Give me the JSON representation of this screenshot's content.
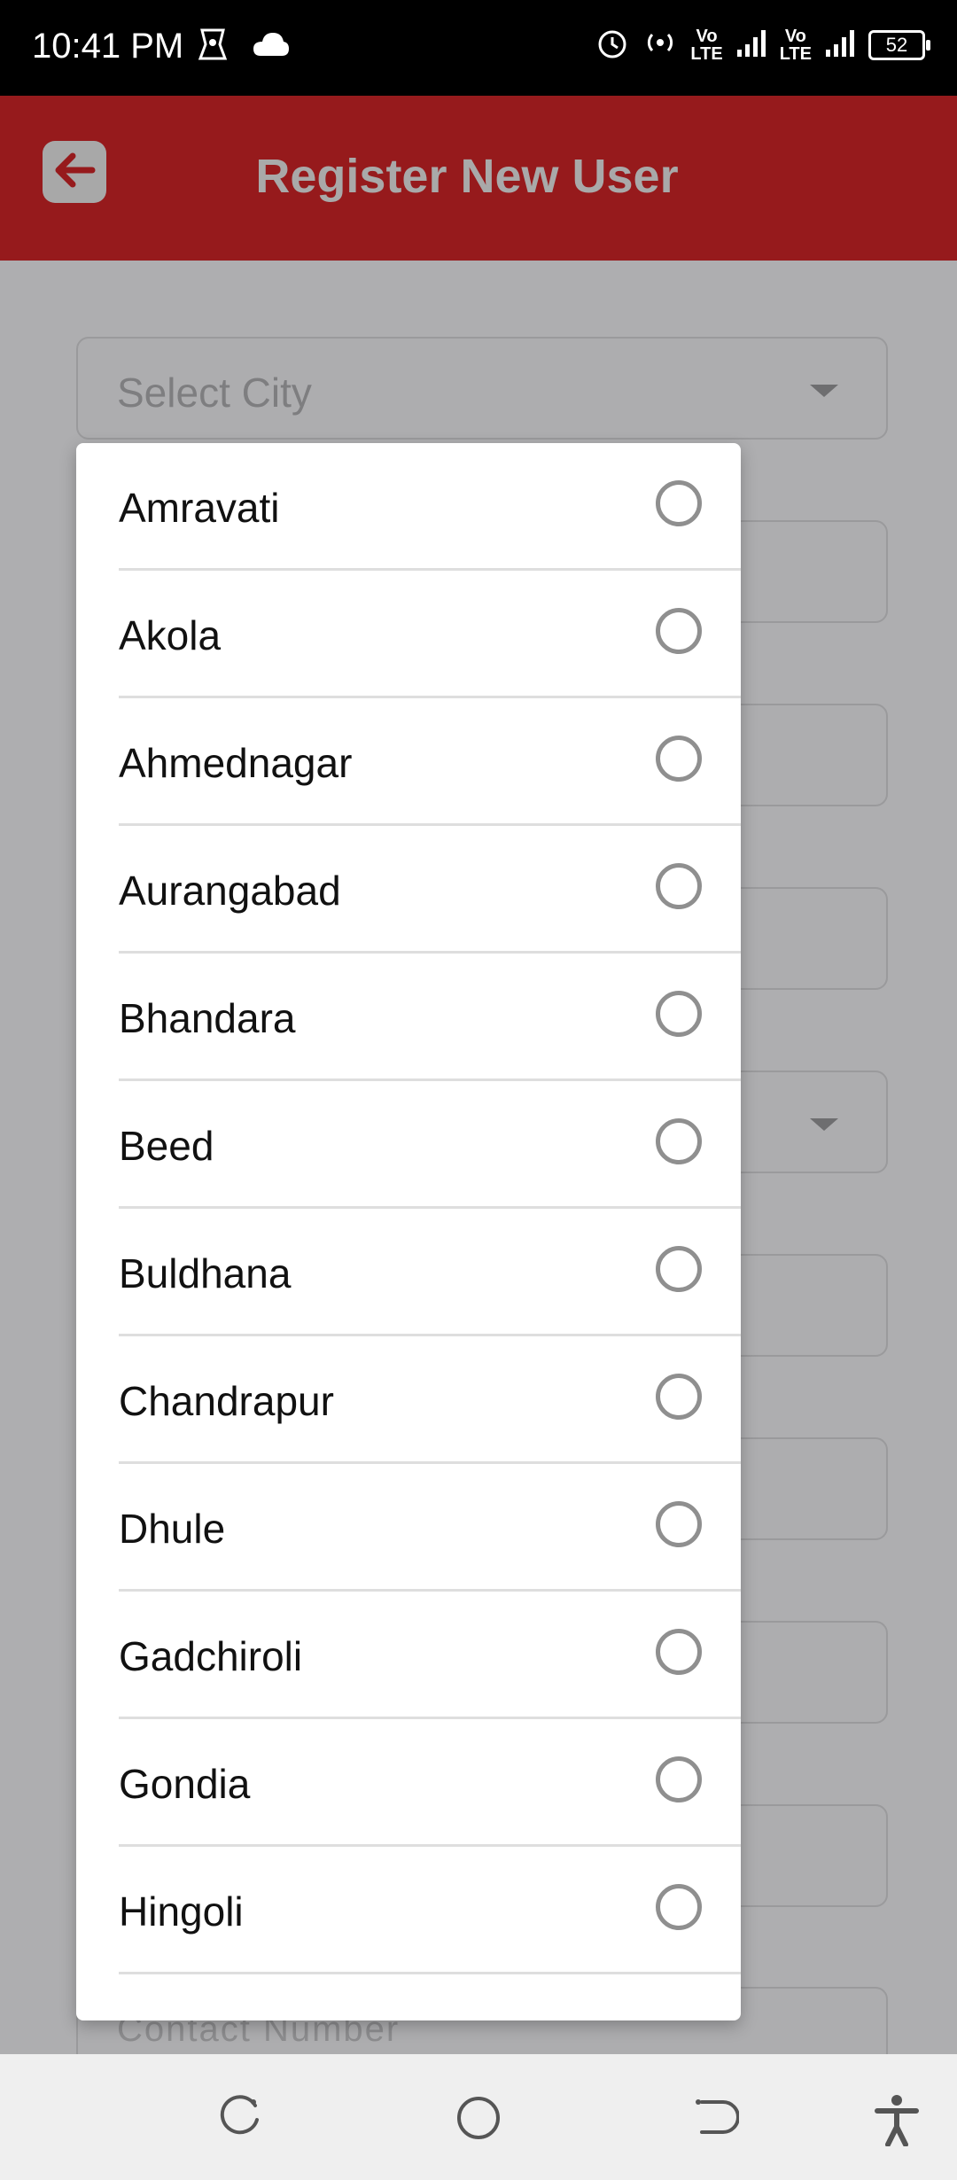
{
  "status_bar": {
    "time": "10:41 PM",
    "lte1": "Vo\nLTE",
    "lte2": "Vo\nLTE",
    "battery": "52",
    "icons": [
      "notification-app-icon",
      "cloud-icon",
      "alarm-icon",
      "hotspot-icon",
      "signal-icon",
      "signal-icon",
      "battery-icon"
    ]
  },
  "appbar": {
    "title": "Register New User",
    "back_icon": "arrow-left-icon"
  },
  "form": {
    "city_placeholder": "Select City",
    "contact_placeholder": "Contact Number"
  },
  "dialog": {
    "options": [
      {
        "label": "Amravati",
        "selected": false
      },
      {
        "label": "Akola",
        "selected": false
      },
      {
        "label": "Ahmednagar",
        "selected": false
      },
      {
        "label": "Aurangabad",
        "selected": false
      },
      {
        "label": "Bhandara",
        "selected": false
      },
      {
        "label": "Beed",
        "selected": false
      },
      {
        "label": "Buldhana",
        "selected": false
      },
      {
        "label": "Chandrapur",
        "selected": false
      },
      {
        "label": "Dhule",
        "selected": false
      },
      {
        "label": "Gadchiroli",
        "selected": false
      },
      {
        "label": "Gondia",
        "selected": false
      },
      {
        "label": "Hingoli",
        "selected": false
      }
    ]
  },
  "navbar": {
    "icons": [
      "recents-icon",
      "home-icon",
      "back-icon",
      "accessibility-icon"
    ]
  },
  "colors": {
    "appbar": "#961a1c",
    "scrim": "#aeaeb0",
    "dialog": "#ffffff"
  }
}
